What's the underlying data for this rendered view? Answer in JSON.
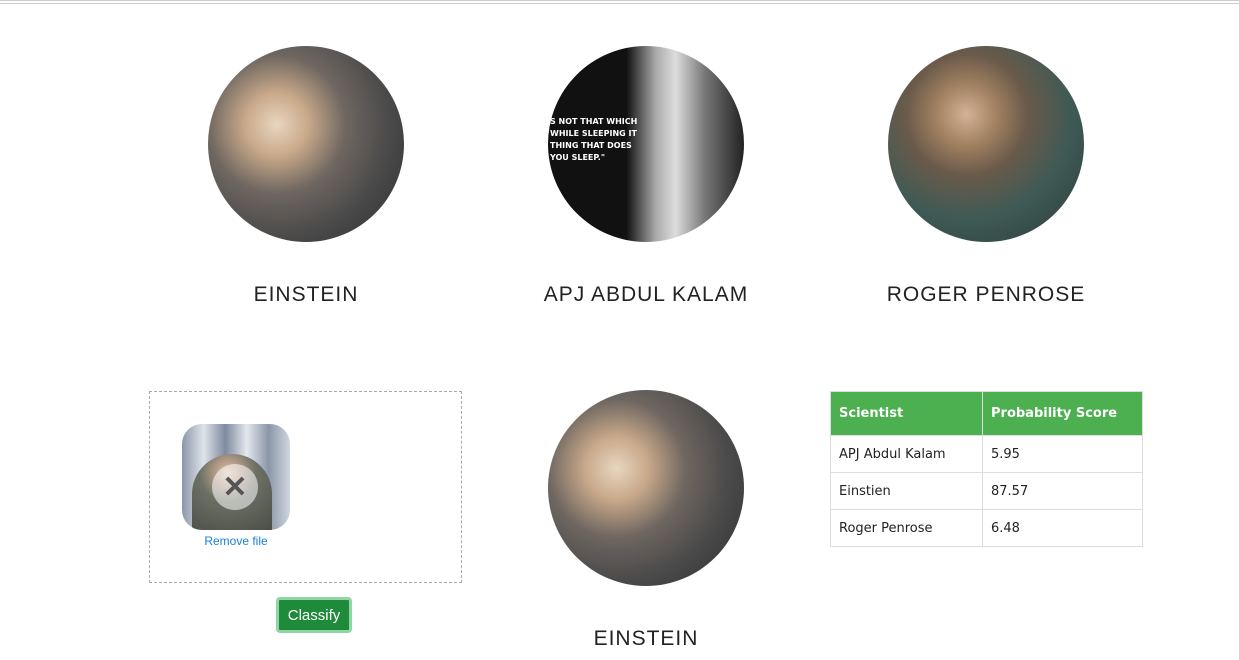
{
  "gallery": [
    {
      "name": "EINSTEIN",
      "photo": "einstein-photo"
    },
    {
      "name": "APJ ABDUL KALAM",
      "photo": "kalam-photo",
      "photo_lettering": [
        "S NOT THAT WHICH",
        "WHILE SLEEPING IT",
        "THING THAT DOES",
        "YOU SLEEP.\""
      ]
    },
    {
      "name": "ROGER PENROSE",
      "photo": "penrose-photo"
    }
  ],
  "upload": {
    "remove_label": "Remove file",
    "remove_icon": "x-icon",
    "classify_label": "Classify"
  },
  "result": {
    "name": "EINSTEIN"
  },
  "table": {
    "headers": [
      "Scientist",
      "Probability Score"
    ],
    "rows": [
      [
        "APJ Abdul Kalam",
        "5.95"
      ],
      [
        "Einstien",
        "87.57"
      ],
      [
        "Roger Penrose",
        "6.48"
      ]
    ]
  },
  "colors": {
    "header_green": "#4caf50",
    "button_green": "#1e8a3a",
    "link_blue": "#1a7fd6"
  }
}
